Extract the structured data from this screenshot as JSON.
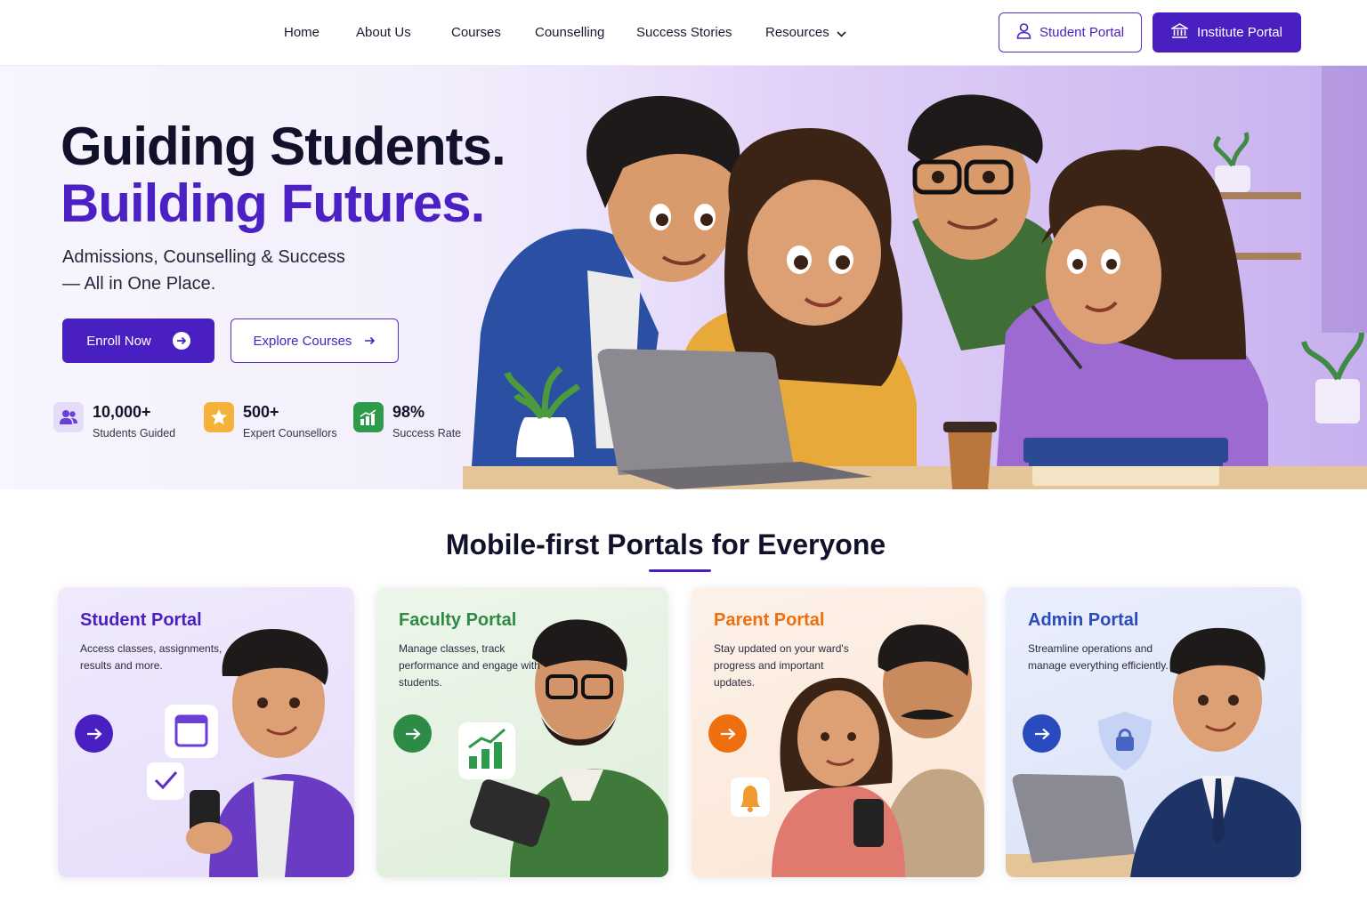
{
  "nav": {
    "links": [
      "Home",
      "About Us",
      "Courses",
      "Counselling",
      "Success Stories",
      "Resources"
    ],
    "student_portal": "Student Portal",
    "institute_portal": "Institute Portal"
  },
  "hero": {
    "title_line1": "Guiding Students.",
    "title_line2": "Building Futures.",
    "subtitle_line1": "Admissions, Counselling & Success",
    "subtitle_line2": "— All in One Place.",
    "enroll_label": "Enroll Now",
    "explore_label": "Explore Courses",
    "stats": [
      {
        "value": "10,000+",
        "label": "Students Guided",
        "icon": "users-icon",
        "color": "#6a3fd6"
      },
      {
        "value": "500+",
        "label": "Expert Counsellors",
        "icon": "star-icon",
        "color": "#f5a623"
      },
      {
        "value": "98%",
        "label": "Success Rate",
        "icon": "growth-chart-icon",
        "color": "#2e9b4b"
      }
    ]
  },
  "portals": {
    "title": "Mobile-first Portals for Everyone",
    "cards": [
      {
        "title": "Student Portal",
        "description": "Access classes, assignments, results and more.",
        "color": "#4a1fc2"
      },
      {
        "title": "Faculty Portal",
        "description": "Manage classes, track performance and engage with students.",
        "color": "#2e8b45"
      },
      {
        "title": "Parent Portal",
        "description": "Stay updated on your ward's progress and important updates.",
        "color": "#ee6f10"
      },
      {
        "title": "Admin Portal",
        "description": "Streamline operations and manage everything efficiently.",
        "color": "#2a4bbf"
      }
    ]
  },
  "colors": {
    "brand": "#4a1fc2",
    "heading": "#11112b"
  }
}
